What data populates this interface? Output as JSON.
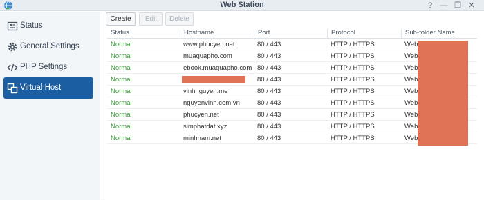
{
  "window": {
    "title": "Web Station",
    "controls": [
      "?",
      "—",
      "❐",
      "✕"
    ]
  },
  "sidebar": {
    "items": [
      {
        "label": "Status",
        "icon": "status-icon"
      },
      {
        "label": "General Settings",
        "icon": "gear-icon"
      },
      {
        "label": "PHP Settings",
        "icon": "code-icon"
      },
      {
        "label": "Virtual Host",
        "icon": "virtual-host-icon",
        "active": true
      }
    ]
  },
  "toolbar": {
    "create_label": "Create",
    "edit_label": "Edit",
    "delete_label": "Delete"
  },
  "table": {
    "columns": [
      "Status",
      "Hostname",
      "Port",
      "Protocol",
      "Sub-folder Name"
    ],
    "rows": [
      {
        "status": "Normal",
        "hostname": "www.phucyen.net",
        "port": "80 / 443",
        "protocol": "HTTP / HTTPS",
        "subfolder": "Web/"
      },
      {
        "status": "Normal",
        "hostname": "muaquapho.com",
        "port": "80 / 443",
        "protocol": "HTTP / HTTPS",
        "subfolder": "Web/"
      },
      {
        "status": "Normal",
        "hostname": "ebook.muaquapho.com",
        "port": "80 / 443",
        "protocol": "HTTP / HTTPS",
        "subfolder": "Web/"
      },
      {
        "status": "Normal",
        "hostname": "",
        "port": "80 / 443",
        "protocol": "HTTP / HTTPS",
        "subfolder": "Web/"
      },
      {
        "status": "Normal",
        "hostname": "vinhnguyen.me",
        "port": "80 / 443",
        "protocol": "HTTP / HTTPS",
        "subfolder": "Web/"
      },
      {
        "status": "Normal",
        "hostname": "nguyenvinh.com.vn",
        "port": "80 / 443",
        "protocol": "HTTP / HTTPS",
        "subfolder": "Web/"
      },
      {
        "status": "Normal",
        "hostname": "phucyen.net",
        "port": "80 / 443",
        "protocol": "HTTP / HTTPS",
        "subfolder": "Web/"
      },
      {
        "status": "Normal",
        "hostname": "simphatdat.xyz",
        "port": "80 / 443",
        "protocol": "HTTP / HTTPS",
        "subfolder": "Web/"
      },
      {
        "status": "Normal",
        "hostname": "minhnam.net",
        "port": "80 / 443",
        "protocol": "HTTP / HTTPS",
        "subfolder": "Web/"
      }
    ]
  },
  "colors": {
    "active_nav": "#1b5ea1",
    "status_normal": "#3c9a3c",
    "redaction": "#e07256"
  }
}
